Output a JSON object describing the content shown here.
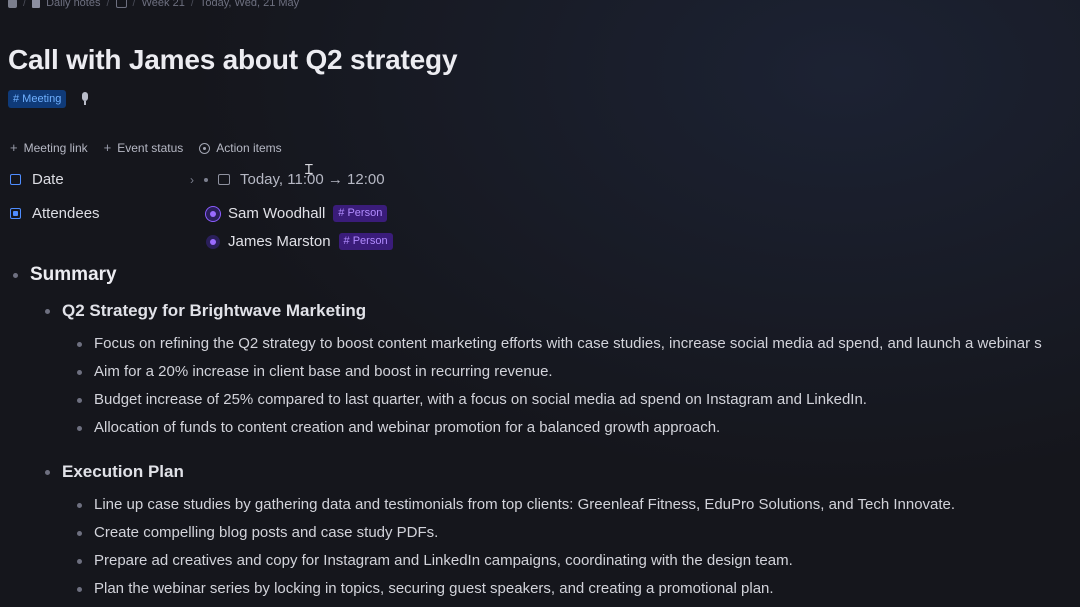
{
  "breadcrumb": {
    "items": [
      "Daily notes",
      "Week 21",
      "Today, Wed, 21 May"
    ]
  },
  "title": "Call with James about Q2 strategy",
  "tags": {
    "meeting": "# Meeting"
  },
  "actions": [
    "Meeting link",
    "Event status",
    "Action items"
  ],
  "properties": {
    "date": {
      "label": "Date",
      "value": "Today, 11:00 → 12:00"
    },
    "attendees": {
      "label": "Attendees",
      "people": [
        {
          "name": "Sam Woodhall",
          "tag": "# Person"
        },
        {
          "name": "James Marston",
          "tag": "# Person"
        }
      ]
    }
  },
  "summary": {
    "heading": "Summary",
    "sections": [
      {
        "heading": "Q2 Strategy for Brightwave Marketing",
        "items": [
          "Focus on refining the Q2 strategy to boost content marketing efforts with case studies, increase social media ad spend, and launch a webinar s",
          "Aim for a 20% increase in client base and boost in recurring revenue.",
          "Budget increase of 25% compared to last quarter, with a focus on social media ad spend on Instagram and LinkedIn.",
          "Allocation of funds to content creation and webinar promotion for a balanced growth approach."
        ]
      },
      {
        "heading": "Execution Plan",
        "items": [
          "Line up case studies by gathering data and testimonials from top clients: Greenleaf Fitness, EduPro Solutions, and Tech Innovate.",
          "Create compelling blog posts and case study PDFs.",
          "Prepare ad creatives and copy for Instagram and LinkedIn campaigns, coordinating with the design team.",
          "Plan the webinar series by locking in topics, securing guest speakers, and creating a promotional plan."
        ]
      }
    ]
  },
  "colors": {
    "background": "#15161c",
    "meeting_tag": "#0f3a78",
    "person_tag": "#3a1c7a",
    "accent": "#4f8dff"
  }
}
